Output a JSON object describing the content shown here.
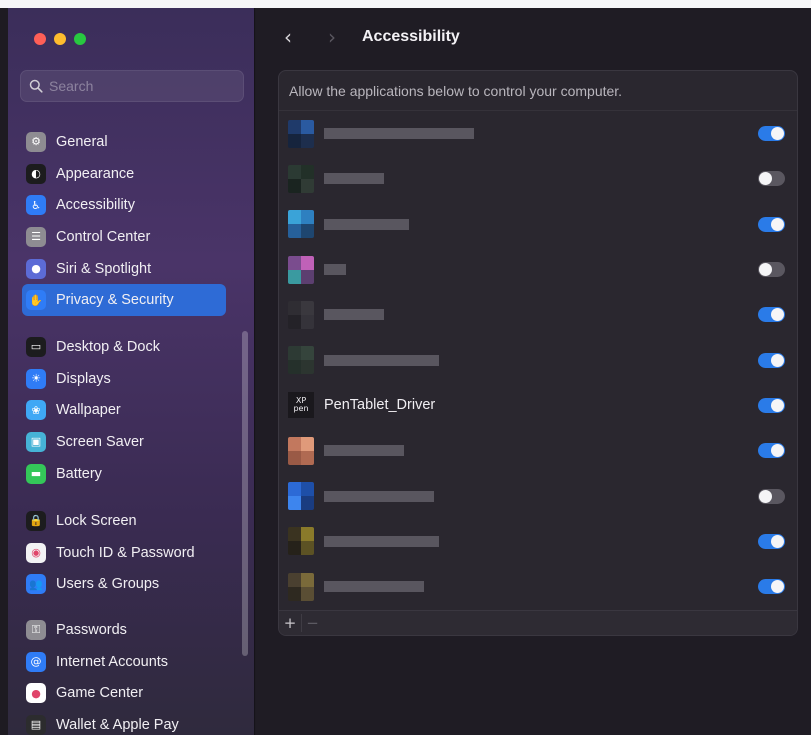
{
  "sidebar": {
    "search_placeholder": "Search",
    "items": [
      {
        "label": "General",
        "icon": "gear-icon",
        "color": "#8e8c92",
        "active": false
      },
      {
        "label": "Appearance",
        "icon": "appearance-icon",
        "color": "#1c1c1e",
        "active": false
      },
      {
        "label": "Accessibility",
        "icon": "accessibility-icon",
        "color": "#2f7cf6",
        "active": false
      },
      {
        "label": "Control Center",
        "icon": "control-center-icon",
        "color": "#8e8c92",
        "active": false
      },
      {
        "label": "Siri & Spotlight",
        "icon": "siri-icon",
        "color": "#5c6bd6",
        "active": false
      },
      {
        "label": "Privacy & Security",
        "icon": "hand-icon",
        "color": "#2f7cf6",
        "active": true
      },
      {
        "label": "Desktop & Dock",
        "icon": "dock-icon",
        "color": "#1c1c1e",
        "active": false
      },
      {
        "label": "Displays",
        "icon": "sun-icon",
        "color": "#2f7cf6",
        "active": false
      },
      {
        "label": "Wallpaper",
        "icon": "flower-icon",
        "color": "#3fa8f5",
        "active": false
      },
      {
        "label": "Screen Saver",
        "icon": "screen-saver-icon",
        "color": "#46b3d6",
        "active": false
      },
      {
        "label": "Battery",
        "icon": "battery-icon",
        "color": "#34c759",
        "active": false
      },
      {
        "label": "Lock Screen",
        "icon": "lock-icon",
        "color": "#1c1c1e",
        "active": false
      },
      {
        "label": "Touch ID & Password",
        "icon": "fingerprint-icon",
        "color": "#f2f2f4",
        "active": false
      },
      {
        "label": "Users & Groups",
        "icon": "users-icon",
        "color": "#2f7cf6",
        "active": false
      },
      {
        "label": "Passwords",
        "icon": "key-icon",
        "color": "#8e8c92",
        "active": false
      },
      {
        "label": "Internet Accounts",
        "icon": "at-icon",
        "color": "#2f7cf6",
        "active": false
      },
      {
        "label": "Game Center",
        "icon": "game-center-icon",
        "color": "#ffffff",
        "active": false
      },
      {
        "label": "Wallet & Apple Pay",
        "icon": "wallet-icon",
        "color": "#2c2c2e",
        "active": false
      }
    ]
  },
  "main": {
    "title": "Accessibility",
    "description": "Allow the applications below to control your computer.",
    "apps": [
      {
        "name": null,
        "enabled": true
      },
      {
        "name": null,
        "enabled": false
      },
      {
        "name": null,
        "enabled": true
      },
      {
        "name": null,
        "enabled": false
      },
      {
        "name": null,
        "enabled": true
      },
      {
        "name": null,
        "enabled": true
      },
      {
        "name": "PenTablet_Driver",
        "icon_text": "XP pen",
        "enabled": true
      },
      {
        "name": null,
        "enabled": true
      },
      {
        "name": null,
        "enabled": false
      },
      {
        "name": null,
        "enabled": true
      },
      {
        "name": null,
        "enabled": true
      }
    ],
    "add_label": "+",
    "remove_label": "−"
  }
}
